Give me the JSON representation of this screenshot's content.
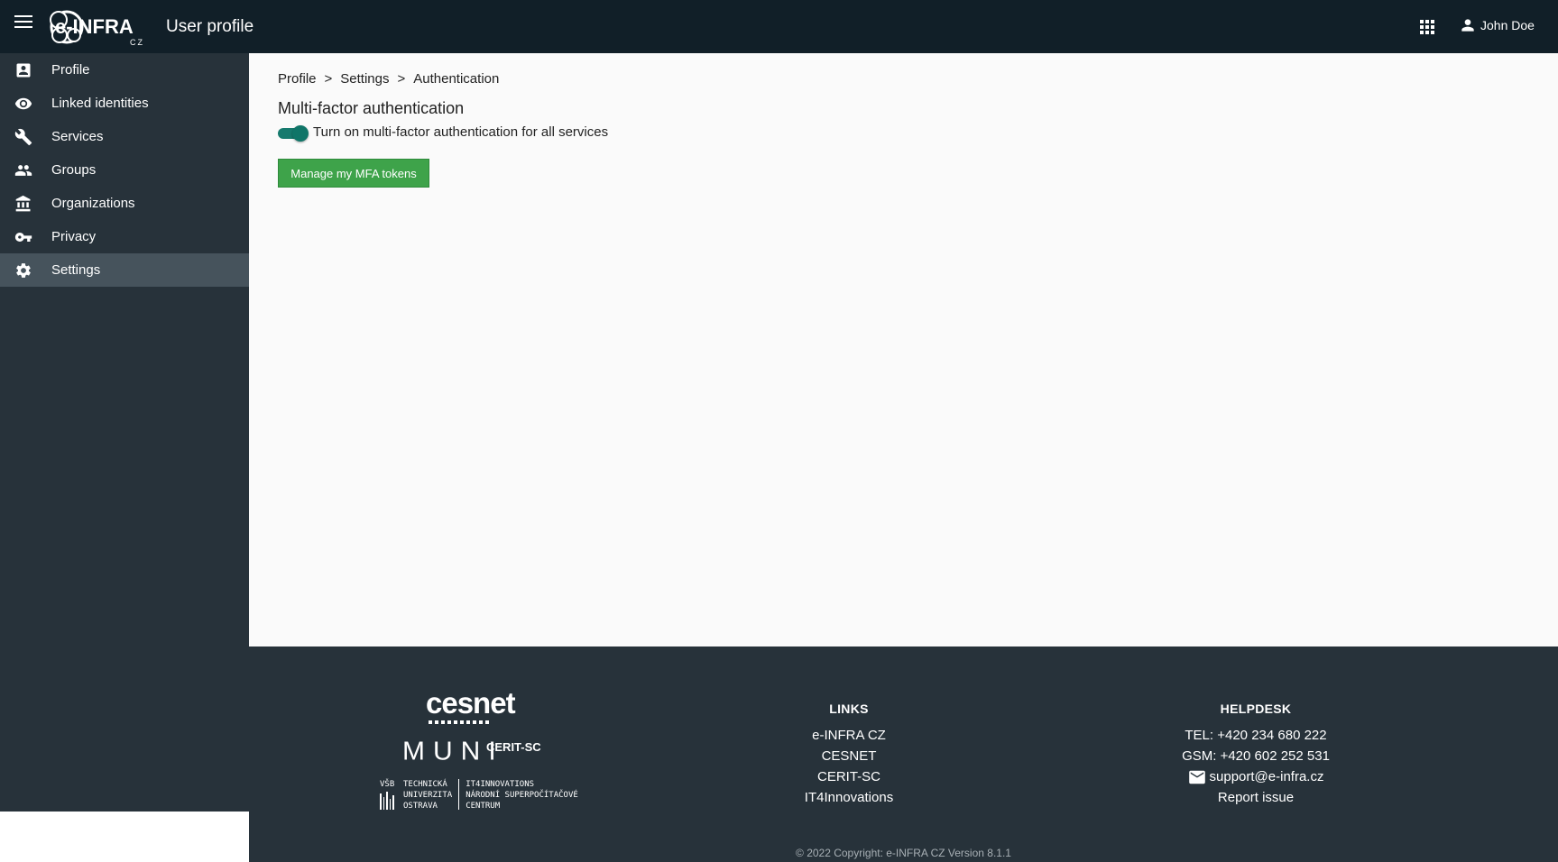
{
  "topbar": {
    "logo_text": "e-INFRA",
    "logo_sub": "CZ",
    "title": "User profile",
    "apps_icon": "apps-grid-icon",
    "user_icon": "person-icon",
    "user_name": "John Doe"
  },
  "sidebar": {
    "items": [
      {
        "label": "Profile",
        "icon": "account-box-icon"
      },
      {
        "label": "Linked identities",
        "icon": "eye-icon"
      },
      {
        "label": "Services",
        "icon": "wrench-icon"
      },
      {
        "label": "Groups",
        "icon": "people-icon"
      },
      {
        "label": "Organizations",
        "icon": "bank-icon"
      },
      {
        "label": "Privacy",
        "icon": "key-icon"
      },
      {
        "label": "Settings",
        "icon": "gear-icon",
        "active": true
      }
    ]
  },
  "main": {
    "breadcrumb": [
      "Profile",
      "Settings",
      "Authentication"
    ],
    "breadcrumb_sep": ">",
    "section_title": "Multi-factor authentication",
    "toggle": {
      "label": "Turn on multi-factor authentication for all services",
      "checked": true
    },
    "mfa_button": "Manage my MFA tokens"
  },
  "footer": {
    "logos": {
      "cesnet": "cesnet",
      "muni": "MUNI",
      "cerit": "CERIT-SC",
      "vsb_left": [
        "VŠB",
        "TECHNICKÁ",
        "UNIVERZITA",
        "OSTRAVA"
      ],
      "vsb_right": [
        "IT4INNOVATIONS",
        "NÁRODNÍ SUPERPOČÍTAČOVÉ",
        "CENTRUM"
      ]
    },
    "links": {
      "heading": "LINKS",
      "items": [
        "e-INFRA CZ",
        "CESNET",
        "CERIT-SC",
        "IT4Innovations"
      ]
    },
    "helpdesk": {
      "heading": "HELPDESK",
      "tel": "TEL: +420 234 680 222",
      "gsm": "GSM: +420 602 252 531",
      "email": "support@e-infra.cz",
      "report": "Report issue"
    },
    "copyright": "© 2022 Copyright: e-INFRA CZ Version 8.1.1"
  },
  "colors": {
    "topbar_bg": "#111f28",
    "sidebar_bg": "#27323a",
    "active_item_bg": "#46535c",
    "toggle": "#0f7568",
    "button_bg": "#3ea34a"
  }
}
